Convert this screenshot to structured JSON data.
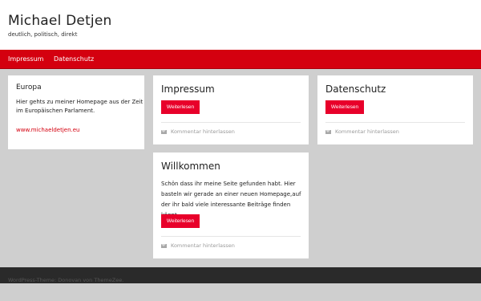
{
  "header": {
    "site_title": "Michael Detjen",
    "site_description": "deutlich, politisch, direkt"
  },
  "nav": {
    "items": [
      {
        "label": "Impressum"
      },
      {
        "label": "Datenschutz"
      }
    ]
  },
  "widget": {
    "title": "Europa",
    "text": "Hier gehts zu meiner Homepage aus der Zeit im Europäischen Parlament.",
    "link": "www.michaeldetjen.eu"
  },
  "posts": [
    {
      "title": "Impressum",
      "button": "Weiterlesen",
      "comment": "Kommentar hinterlassen"
    },
    {
      "title": "Datenschutz",
      "button": "Weiterlesen",
      "comment": "Kommentar hinterlassen"
    },
    {
      "title": "Willkommen",
      "text": "Schön dass ihr meine Seite gefunden habt. Hier basteln wir gerade an einer neuen Homepage,auf der ihr bald viele interessante Beiträge finden könnt.",
      "button": "Weiterlesen",
      "comment": "Kommentar hinterlassen"
    }
  ],
  "footer": {
    "text": "WordPress-Theme: Donovan von ThemeZee."
  },
  "colors": {
    "accent": "#d4000f",
    "button": "#e8002a",
    "background": "#cfcfcf",
    "footer": "#2a2a2a"
  }
}
